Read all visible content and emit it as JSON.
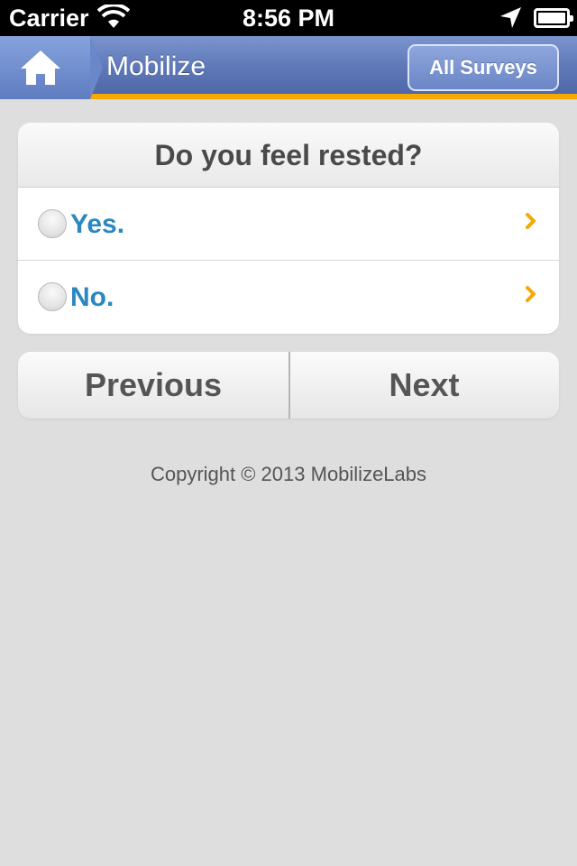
{
  "status_bar": {
    "carrier": "Carrier",
    "time": "8:56 PM"
  },
  "header": {
    "title": "Mobilize",
    "all_surveys_label": "All Surveys"
  },
  "question": {
    "text": "Do you feel rested?",
    "options": [
      {
        "label": "Yes."
      },
      {
        "label": "No."
      }
    ]
  },
  "nav": {
    "previous_label": "Previous",
    "next_label": "Next"
  },
  "footer": {
    "copyright": "Copyright © 2013 MobilizeLabs"
  },
  "colors": {
    "accent_orange": "#f5a800",
    "header_blue": "#5e78b8",
    "option_text_blue": "#2a87c2"
  },
  "icons": {
    "home": "home-icon",
    "chevron": "chevron-right-icon",
    "wifi": "wifi-icon",
    "location": "location-arrow-icon",
    "battery": "battery-icon"
  }
}
